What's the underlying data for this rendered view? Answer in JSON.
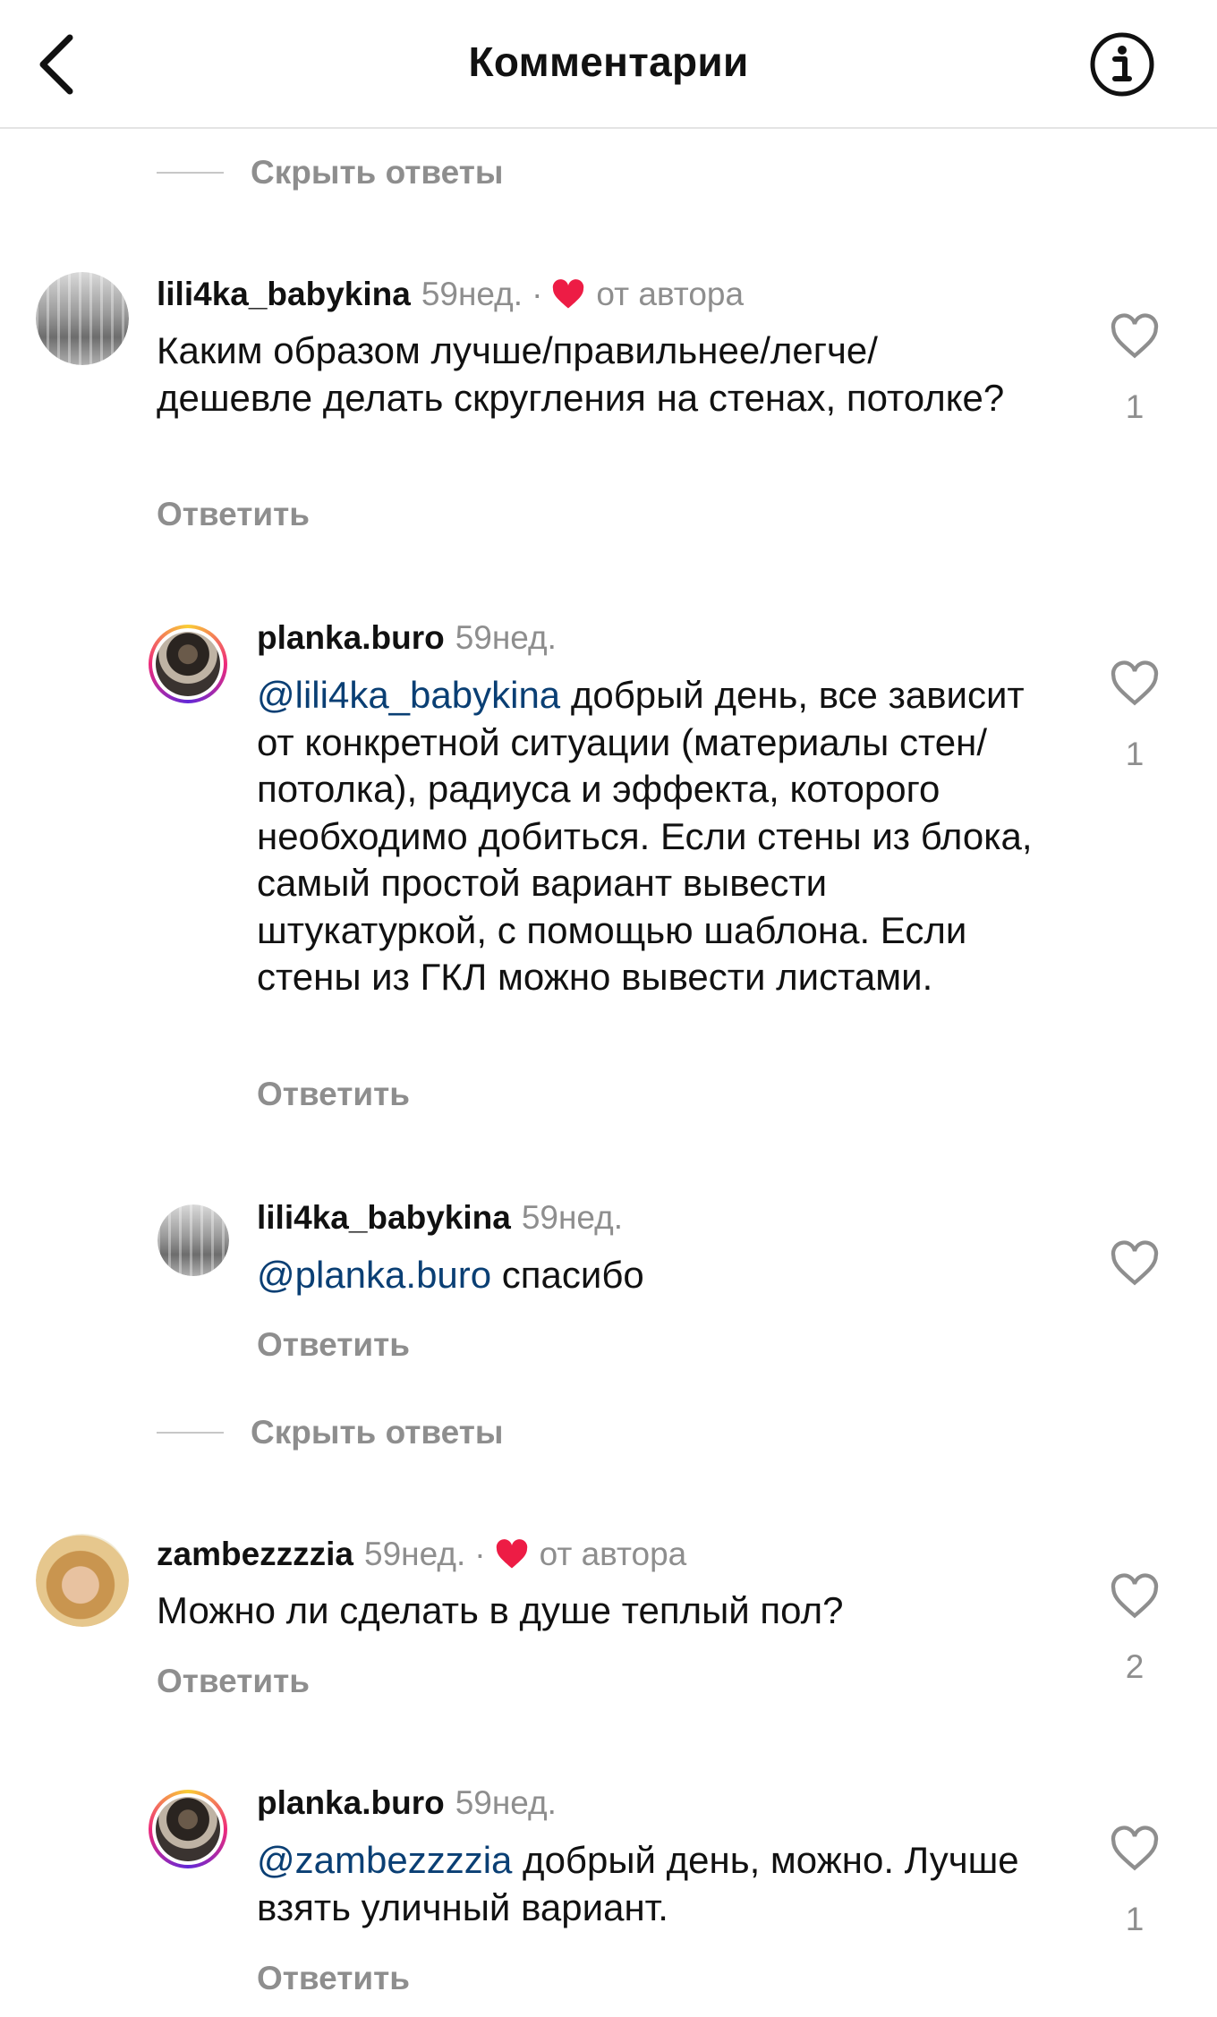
{
  "header": {
    "title": "Комментарии"
  },
  "hide_replies_label": "Скрыть ответы",
  "by_author_label": "от автора",
  "reply_label": "Ответить",
  "comments": [
    {
      "username": "lili4ka_babykina",
      "time": "59нед.",
      "text": "Каким образом лучше/правильнее/легче/ дешевле делать скругления на стенах, потолке?",
      "likes": "1"
    },
    {
      "username": "planka.buro",
      "time": "59нед.",
      "mention": "@lili4ka_babykina",
      "text": " добрый день, все зависит от конкретной ситуации (материалы стен/потолка), радиуса и эффекта, которого необходимо добиться. Если стены из блока, самый простой вариант вывести штукатуркой, с помощью шаблона. Если стены из ГКЛ можно вывести листами.",
      "likes": "1"
    },
    {
      "username": "lili4ka_babykina",
      "time": "59нед.",
      "mention": "@planka.buro",
      "text": " спасибо"
    },
    {
      "username": "zambezzzzia",
      "time": "59нед.",
      "text": "Можно ли сделать в душе теплый пол?",
      "likes": "2"
    },
    {
      "username": "planka.buro",
      "time": "59нед.",
      "mention": "@zambezzzzia",
      "text": " добрый день, можно. Лучше взять уличный вариант.",
      "likes": "1"
    }
  ],
  "colors": {
    "heart_red": "#ed1c45",
    "mention": "#0a3f74",
    "muted": "#8e8e8e"
  },
  "icons": {
    "back": "chevron-left-icon",
    "info": "info-icon",
    "like": "heart-outline-icon",
    "liked_by_author": "heart-filled-icon"
  }
}
